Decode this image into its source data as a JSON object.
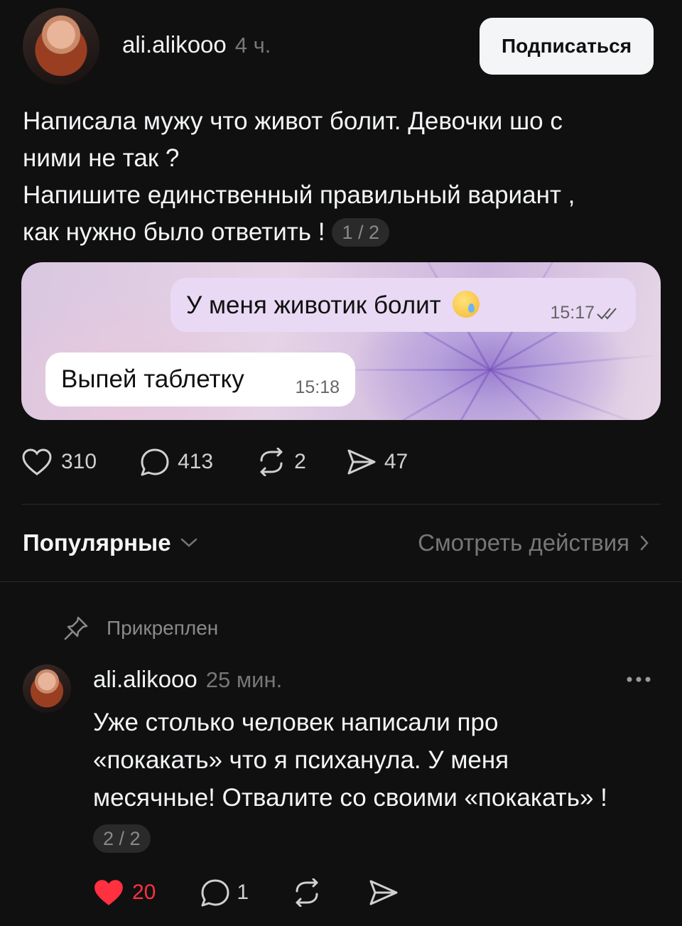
{
  "post": {
    "username": "ali.alikooo",
    "time": "4 ч.",
    "follow_label": "Подписаться",
    "text_lines": [
      "Написала мужу что живот болит. Девочки шо с",
      "ними не так ?",
      "Напишите единственный  правильный вариант ,",
      "как нужно было ответить !"
    ],
    "page_badge": "1 / 2",
    "image": {
      "message_out": "У меня животик болит",
      "message_out_time": "15:17",
      "message_in": "Выпей таблетку",
      "message_in_time": "15:18"
    },
    "likes": "310",
    "comments": "413",
    "reposts": "2",
    "shares": "47"
  },
  "sort": {
    "label": "Популярные",
    "view_actions": "Смотреть действия"
  },
  "comment": {
    "pinned_label": "Прикреплен",
    "username": "ali.alikooo",
    "time": "25 мин.",
    "text_lines": [
      "Уже столько человек написали про",
      "«покакать» что я психанула. У меня",
      "месячные! Отвалите со своими «покакать» !"
    ],
    "page_badge": "2 / 2",
    "likes": "20",
    "replies": "1",
    "liked_color": "#ff3040"
  }
}
